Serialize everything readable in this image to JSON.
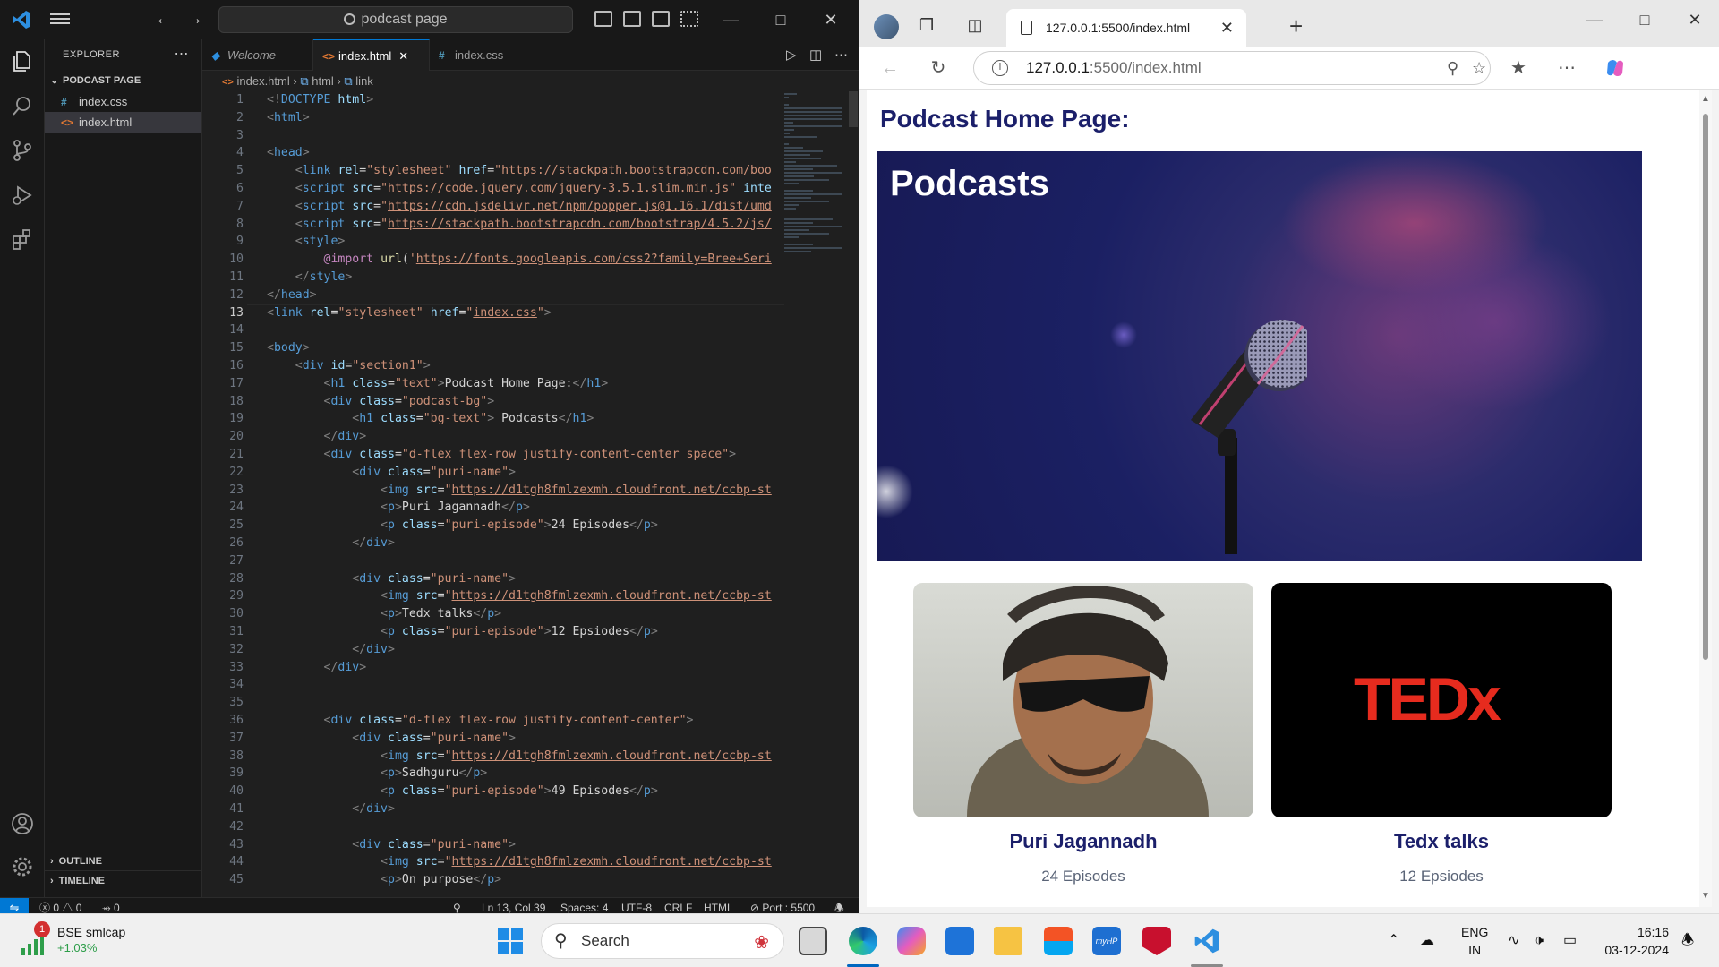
{
  "vscode": {
    "search_text": "podcast page",
    "sidebar": {
      "title": "EXPLORER",
      "folder": "PODCAST PAGE",
      "files": [
        {
          "icon": "#",
          "name": "index.css",
          "color": "#519aba"
        },
        {
          "icon": "<>",
          "name": "index.html",
          "color": "#e37933"
        }
      ],
      "outline": "OUTLINE",
      "timeline": "TIMELINE"
    },
    "tabs": [
      {
        "label": "Welcome",
        "icon": "vscode-logo-icon"
      },
      {
        "label": "index.html",
        "icon": "html-file-icon"
      },
      {
        "label": "index.css",
        "icon": "css-file-icon"
      }
    ],
    "breadcrumb": {
      "file": "index.html",
      "html": "html",
      "link": "link"
    },
    "current_line": 13,
    "status": {
      "errors": "0",
      "warnings": "0",
      "ports": "0",
      "position": "Ln 13, Col 39",
      "spaces": "Spaces: 4",
      "encoding": "UTF-8",
      "eol": "CRLF",
      "language": "HTML",
      "port": "Port : 5500"
    },
    "code": [
      [
        [
          "ang",
          "<!"
        ],
        [
          "tag",
          "DOCTYPE"
        ],
        [
          "txt",
          " "
        ],
        [
          "attr",
          "html"
        ],
        [
          "ang",
          ">"
        ]
      ],
      [
        [
          "ang",
          "<"
        ],
        [
          "tag",
          "html"
        ],
        [
          "ang",
          ">"
        ]
      ],
      [],
      [
        [
          "ang",
          "<"
        ],
        [
          "tag",
          "head"
        ],
        [
          "ang",
          ">"
        ]
      ],
      [
        [
          "txt",
          "    "
        ],
        [
          "ang",
          "<"
        ],
        [
          "tag",
          "link"
        ],
        [
          "txt",
          " "
        ],
        [
          "attr",
          "rel"
        ],
        [
          "txt",
          "="
        ],
        [
          "str",
          "\"stylesheet\""
        ],
        [
          "txt",
          " "
        ],
        [
          "attr",
          "href"
        ],
        [
          "txt",
          "="
        ],
        [
          "str",
          "\""
        ],
        [
          "url",
          "https://stackpath.bootstrapcdn.com/boo"
        ]
      ],
      [
        [
          "txt",
          "    "
        ],
        [
          "ang",
          "<"
        ],
        [
          "tag",
          "script"
        ],
        [
          "txt",
          " "
        ],
        [
          "attr",
          "src"
        ],
        [
          "txt",
          "="
        ],
        [
          "str",
          "\""
        ],
        [
          "url",
          "https://code.jquery.com/jquery-3.5.1.slim.min.js"
        ],
        [
          "str",
          "\""
        ],
        [
          "txt",
          " "
        ],
        [
          "attr",
          "inte"
        ]
      ],
      [
        [
          "txt",
          "    "
        ],
        [
          "ang",
          "<"
        ],
        [
          "tag",
          "script"
        ],
        [
          "txt",
          " "
        ],
        [
          "attr",
          "src"
        ],
        [
          "txt",
          "="
        ],
        [
          "str",
          "\""
        ],
        [
          "url",
          "https://cdn.jsdelivr.net/npm/popper.js@1.16.1/dist/umd"
        ]
      ],
      [
        [
          "txt",
          "    "
        ],
        [
          "ang",
          "<"
        ],
        [
          "tag",
          "script"
        ],
        [
          "txt",
          " "
        ],
        [
          "attr",
          "src"
        ],
        [
          "txt",
          "="
        ],
        [
          "str",
          "\""
        ],
        [
          "url",
          "https://stackpath.bootstrapcdn.com/bootstrap/4.5.2/js/"
        ]
      ],
      [
        [
          "txt",
          "    "
        ],
        [
          "ang",
          "<"
        ],
        [
          "tag",
          "style"
        ],
        [
          "ang",
          ">"
        ]
      ],
      [
        [
          "txt",
          "        "
        ],
        [
          "at",
          "@import"
        ],
        [
          "txt",
          " "
        ],
        [
          "fn",
          "url"
        ],
        [
          "txt",
          "("
        ],
        [
          "str",
          "'"
        ],
        [
          "url",
          "https://fonts.googleapis.com/css2?family=Bree+Seri"
        ]
      ],
      [
        [
          "txt",
          "    "
        ],
        [
          "ang",
          "</"
        ],
        [
          "tag",
          "style"
        ],
        [
          "ang",
          ">"
        ]
      ],
      [
        [
          "ang",
          "</"
        ],
        [
          "tag",
          "head"
        ],
        [
          "ang",
          ">"
        ]
      ],
      [
        [
          "ang",
          "<"
        ],
        [
          "tag",
          "link"
        ],
        [
          "txt",
          " "
        ],
        [
          "attr",
          "rel"
        ],
        [
          "txt",
          "="
        ],
        [
          "str",
          "\"stylesheet\""
        ],
        [
          "txt",
          " "
        ],
        [
          "attr",
          "href"
        ],
        [
          "txt",
          "="
        ],
        [
          "str",
          "\""
        ],
        [
          "url",
          "index.css"
        ],
        [
          "str",
          "\""
        ],
        [
          "ang",
          ">"
        ]
      ],
      [],
      [
        [
          "ang",
          "<"
        ],
        [
          "tag",
          "body"
        ],
        [
          "ang",
          ">"
        ]
      ],
      [
        [
          "txt",
          "    "
        ],
        [
          "ang",
          "<"
        ],
        [
          "tag",
          "div"
        ],
        [
          "txt",
          " "
        ],
        [
          "attr",
          "id"
        ],
        [
          "txt",
          "="
        ],
        [
          "str",
          "\"section1\""
        ],
        [
          "ang",
          ">"
        ]
      ],
      [
        [
          "txt",
          "        "
        ],
        [
          "ang",
          "<"
        ],
        [
          "tag",
          "h1"
        ],
        [
          "txt",
          " "
        ],
        [
          "attr",
          "class"
        ],
        [
          "txt",
          "="
        ],
        [
          "str",
          "\"text\""
        ],
        [
          "ang",
          ">"
        ],
        [
          "txt",
          "Podcast Home Page:"
        ],
        [
          "ang",
          "</"
        ],
        [
          "tag",
          "h1"
        ],
        [
          "ang",
          ">"
        ]
      ],
      [
        [
          "txt",
          "        "
        ],
        [
          "ang",
          "<"
        ],
        [
          "tag",
          "div"
        ],
        [
          "txt",
          " "
        ],
        [
          "attr",
          "class"
        ],
        [
          "txt",
          "="
        ],
        [
          "str",
          "\"podcast-bg\""
        ],
        [
          "ang",
          ">"
        ]
      ],
      [
        [
          "txt",
          "            "
        ],
        [
          "ang",
          "<"
        ],
        [
          "tag",
          "h1"
        ],
        [
          "txt",
          " "
        ],
        [
          "attr",
          "class"
        ],
        [
          "txt",
          "="
        ],
        [
          "str",
          "\"bg-text\""
        ],
        [
          "ang",
          ">"
        ],
        [
          "txt",
          " Podcasts"
        ],
        [
          "ang",
          "</"
        ],
        [
          "tag",
          "h1"
        ],
        [
          "ang",
          ">"
        ]
      ],
      [
        [
          "txt",
          "        "
        ],
        [
          "ang",
          "</"
        ],
        [
          "tag",
          "div"
        ],
        [
          "ang",
          ">"
        ]
      ],
      [
        [
          "txt",
          "        "
        ],
        [
          "ang",
          "<"
        ],
        [
          "tag",
          "div"
        ],
        [
          "txt",
          " "
        ],
        [
          "attr",
          "class"
        ],
        [
          "txt",
          "="
        ],
        [
          "str",
          "\"d-flex flex-row justify-content-center space\""
        ],
        [
          "ang",
          ">"
        ]
      ],
      [
        [
          "txt",
          "            "
        ],
        [
          "ang",
          "<"
        ],
        [
          "tag",
          "div"
        ],
        [
          "txt",
          " "
        ],
        [
          "attr",
          "class"
        ],
        [
          "txt",
          "="
        ],
        [
          "str",
          "\"puri-name\""
        ],
        [
          "ang",
          ">"
        ]
      ],
      [
        [
          "txt",
          "                "
        ],
        [
          "ang",
          "<"
        ],
        [
          "tag",
          "img"
        ],
        [
          "txt",
          " "
        ],
        [
          "attr",
          "src"
        ],
        [
          "txt",
          "="
        ],
        [
          "str",
          "\""
        ],
        [
          "url",
          "https://d1tgh8fmlzexmh.cloudfront.net/ccbp-st"
        ]
      ],
      [
        [
          "txt",
          "                "
        ],
        [
          "ang",
          "<"
        ],
        [
          "tag",
          "p"
        ],
        [
          "ang",
          ">"
        ],
        [
          "txt",
          "Puri Jagannadh"
        ],
        [
          "ang",
          "</"
        ],
        [
          "tag",
          "p"
        ],
        [
          "ang",
          ">"
        ]
      ],
      [
        [
          "txt",
          "                "
        ],
        [
          "ang",
          "<"
        ],
        [
          "tag",
          "p"
        ],
        [
          "txt",
          " "
        ],
        [
          "attr",
          "class"
        ],
        [
          "txt",
          "="
        ],
        [
          "str",
          "\"puri-episode\""
        ],
        [
          "ang",
          ">"
        ],
        [
          "txt",
          "24 Episodes"
        ],
        [
          "ang",
          "</"
        ],
        [
          "tag",
          "p"
        ],
        [
          "ang",
          ">"
        ]
      ],
      [
        [
          "txt",
          "            "
        ],
        [
          "ang",
          "</"
        ],
        [
          "tag",
          "div"
        ],
        [
          "ang",
          ">"
        ]
      ],
      [],
      [
        [
          "txt",
          "            "
        ],
        [
          "ang",
          "<"
        ],
        [
          "tag",
          "div"
        ],
        [
          "txt",
          " "
        ],
        [
          "attr",
          "class"
        ],
        [
          "txt",
          "="
        ],
        [
          "str",
          "\"puri-name\""
        ],
        [
          "ang",
          ">"
        ]
      ],
      [
        [
          "txt",
          "                "
        ],
        [
          "ang",
          "<"
        ],
        [
          "tag",
          "img"
        ],
        [
          "txt",
          " "
        ],
        [
          "attr",
          "src"
        ],
        [
          "txt",
          "="
        ],
        [
          "str",
          "\""
        ],
        [
          "url",
          "https://d1tgh8fmlzexmh.cloudfront.net/ccbp-st"
        ]
      ],
      [
        [
          "txt",
          "                "
        ],
        [
          "ang",
          "<"
        ],
        [
          "tag",
          "p"
        ],
        [
          "ang",
          ">"
        ],
        [
          "txt",
          "Tedx talks"
        ],
        [
          "ang",
          "</"
        ],
        [
          "tag",
          "p"
        ],
        [
          "ang",
          ">"
        ]
      ],
      [
        [
          "txt",
          "                "
        ],
        [
          "ang",
          "<"
        ],
        [
          "tag",
          "p"
        ],
        [
          "txt",
          " "
        ],
        [
          "attr",
          "class"
        ],
        [
          "txt",
          "="
        ],
        [
          "str",
          "\"puri-episode\""
        ],
        [
          "ang",
          ">"
        ],
        [
          "txt",
          "12 Epsiodes"
        ],
        [
          "ang",
          "</"
        ],
        [
          "tag",
          "p"
        ],
        [
          "ang",
          ">"
        ]
      ],
      [
        [
          "txt",
          "            "
        ],
        [
          "ang",
          "</"
        ],
        [
          "tag",
          "div"
        ],
        [
          "ang",
          ">"
        ]
      ],
      [
        [
          "txt",
          "        "
        ],
        [
          "ang",
          "</"
        ],
        [
          "tag",
          "div"
        ],
        [
          "ang",
          ">"
        ]
      ],
      [],
      [],
      [
        [
          "txt",
          "        "
        ],
        [
          "ang",
          "<"
        ],
        [
          "tag",
          "div"
        ],
        [
          "txt",
          " "
        ],
        [
          "attr",
          "class"
        ],
        [
          "txt",
          "="
        ],
        [
          "str",
          "\"d-flex flex-row justify-content-center\""
        ],
        [
          "ang",
          ">"
        ]
      ],
      [
        [
          "txt",
          "            "
        ],
        [
          "ang",
          "<"
        ],
        [
          "tag",
          "div"
        ],
        [
          "txt",
          " "
        ],
        [
          "attr",
          "class"
        ],
        [
          "txt",
          "="
        ],
        [
          "str",
          "\"puri-name\""
        ],
        [
          "ang",
          ">"
        ]
      ],
      [
        [
          "txt",
          "                "
        ],
        [
          "ang",
          "<"
        ],
        [
          "tag",
          "img"
        ],
        [
          "txt",
          " "
        ],
        [
          "attr",
          "src"
        ],
        [
          "txt",
          "="
        ],
        [
          "str",
          "\""
        ],
        [
          "url",
          "https://d1tgh8fmlzexmh.cloudfront.net/ccbp-st"
        ]
      ],
      [
        [
          "txt",
          "                "
        ],
        [
          "ang",
          "<"
        ],
        [
          "tag",
          "p"
        ],
        [
          "ang",
          ">"
        ],
        [
          "txt",
          "Sadhguru"
        ],
        [
          "ang",
          "</"
        ],
        [
          "tag",
          "p"
        ],
        [
          "ang",
          ">"
        ]
      ],
      [
        [
          "txt",
          "                "
        ],
        [
          "ang",
          "<"
        ],
        [
          "tag",
          "p"
        ],
        [
          "txt",
          " "
        ],
        [
          "attr",
          "class"
        ],
        [
          "txt",
          "="
        ],
        [
          "str",
          "\"puri-episode\""
        ],
        [
          "ang",
          ">"
        ],
        [
          "txt",
          "49 Episodes"
        ],
        [
          "ang",
          "</"
        ],
        [
          "tag",
          "p"
        ],
        [
          "ang",
          ">"
        ]
      ],
      [
        [
          "txt",
          "            "
        ],
        [
          "ang",
          "</"
        ],
        [
          "tag",
          "div"
        ],
        [
          "ang",
          ">"
        ]
      ],
      [],
      [
        [
          "txt",
          "            "
        ],
        [
          "ang",
          "<"
        ],
        [
          "tag",
          "div"
        ],
        [
          "txt",
          " "
        ],
        [
          "attr",
          "class"
        ],
        [
          "txt",
          "="
        ],
        [
          "str",
          "\"puri-name\""
        ],
        [
          "ang",
          ">"
        ]
      ],
      [
        [
          "txt",
          "                "
        ],
        [
          "ang",
          "<"
        ],
        [
          "tag",
          "img"
        ],
        [
          "txt",
          " "
        ],
        [
          "attr",
          "src"
        ],
        [
          "txt",
          "="
        ],
        [
          "str",
          "\""
        ],
        [
          "url",
          "https://d1tgh8fmlzexmh.cloudfront.net/ccbp-st"
        ]
      ],
      [
        [
          "txt",
          "                "
        ],
        [
          "ang",
          "<"
        ],
        [
          "tag",
          "p"
        ],
        [
          "ang",
          ">"
        ],
        [
          "txt",
          "On purpose"
        ],
        [
          "ang",
          "</"
        ],
        [
          "tag",
          "p"
        ],
        [
          "ang",
          ">"
        ]
      ]
    ]
  },
  "browser": {
    "tab_title": "127.0.0.1:5500/index.html",
    "url_host": "127.0.0.1",
    "url_rest": ":5500/index.html",
    "page": {
      "heading": "Podcast Home Page:",
      "hero_text": "Podcasts",
      "cards": [
        {
          "name": "Puri Jagannadh",
          "episodes": "24 Episodes"
        },
        {
          "name": "Tedx talks",
          "episodes": "12 Epsiodes"
        }
      ],
      "tedx_logo": "TEDx"
    }
  },
  "taskbar": {
    "widget_title": "BSE smlcap",
    "widget_value": "+1.03%",
    "widget_badge": "1",
    "search_placeholder": "Search",
    "lang_line1": "ENG",
    "lang_line2": "IN",
    "time": "16:16",
    "date": "03-12-2024"
  },
  "colors": {
    "vscode_accent": "#0078d4",
    "page_heading": "#1b1f6a",
    "tedx_red": "#e62b1e"
  }
}
